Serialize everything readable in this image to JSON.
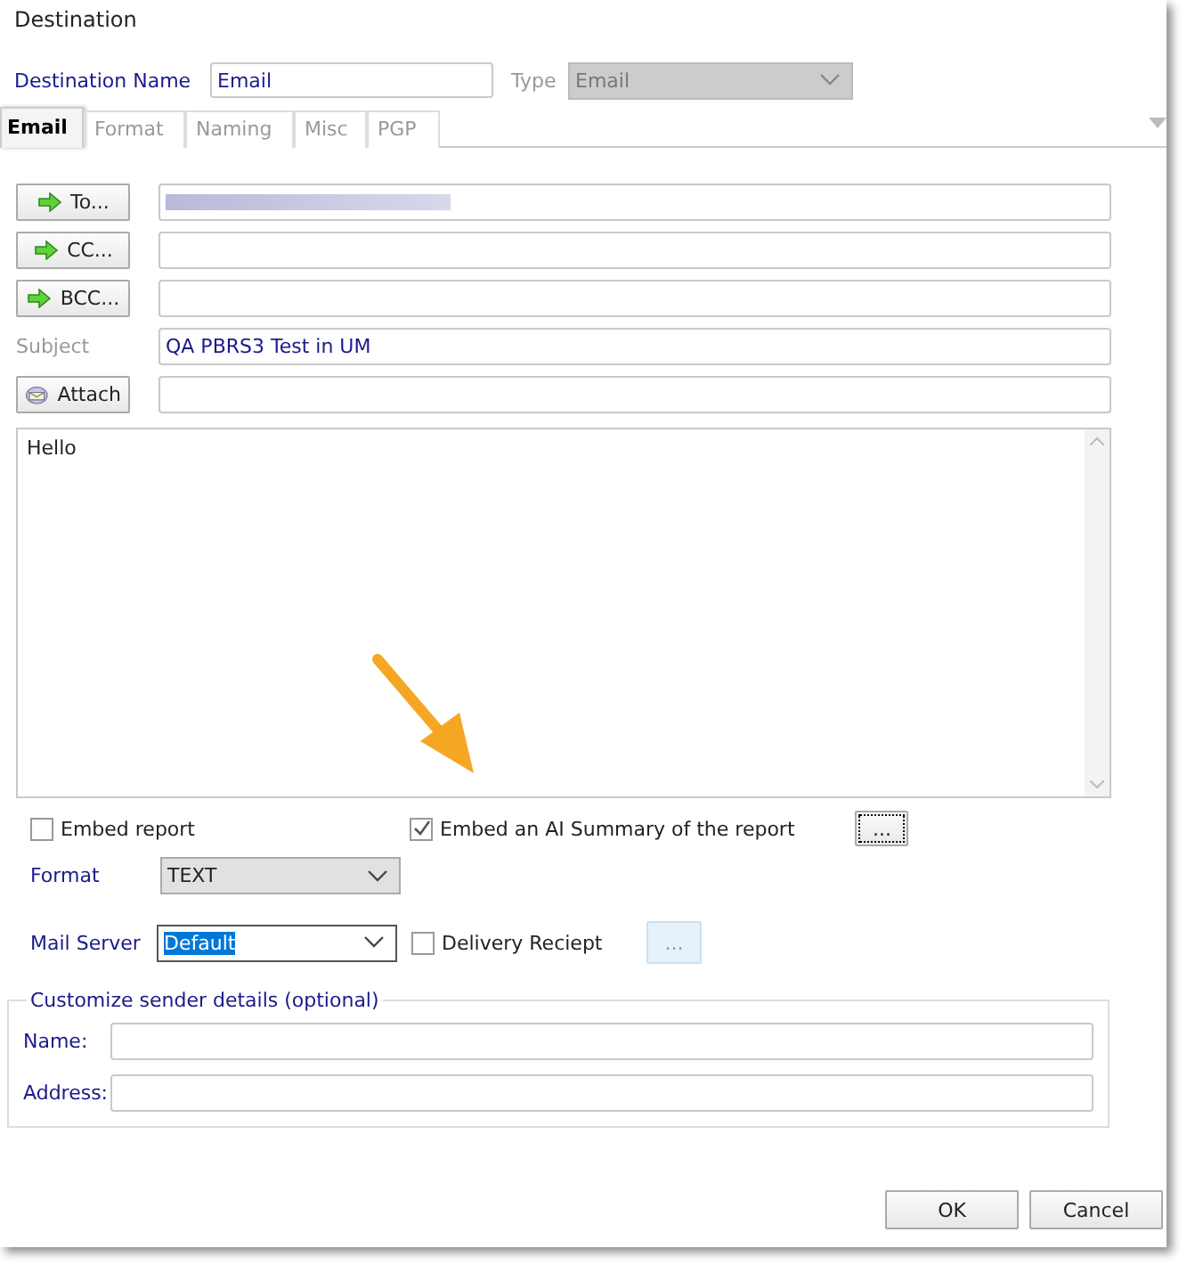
{
  "window": {
    "title": "Destination"
  },
  "destination_name": {
    "label": "Destination Name",
    "value": "Email"
  },
  "type": {
    "label": "Type",
    "value": "Email",
    "disabled": true
  },
  "tabs": [
    {
      "label": "Email",
      "selected": true
    },
    {
      "label": "Format",
      "selected": false
    },
    {
      "label": "Naming",
      "selected": false
    },
    {
      "label": "Misc",
      "selected": false
    },
    {
      "label": "PGP",
      "selected": false
    }
  ],
  "recipients": [
    {
      "kind": "button",
      "label": "To...",
      "redacted": true
    },
    {
      "kind": "button",
      "label": "CC...",
      "redacted": false
    },
    {
      "kind": "button",
      "label": "BCC...",
      "redacted": false
    },
    {
      "kind": "label",
      "label": "Subject",
      "value": "QA PBRS3 Test in UM",
      "redacted": false
    },
    {
      "kind": "attach",
      "label": "Attach",
      "redacted": false
    }
  ],
  "message_body": "Hello",
  "embed_report": {
    "label": "Embed report",
    "checked": false
  },
  "embed_ai_summary": {
    "label": "Embed an AI Summary of the report",
    "checked": true,
    "button": "..."
  },
  "format": {
    "label": "Format",
    "value": "TEXT"
  },
  "mail_server": {
    "label": "Mail Server",
    "value": "Default",
    "selected": true
  },
  "delivery_receipt": {
    "label": "Delivery Reciept",
    "checked": false,
    "button": "...",
    "button_disabled": true
  },
  "sender_group": {
    "title": "Customize sender details (optional)",
    "fields": [
      {
        "label": "Name:"
      },
      {
        "label": "Address:"
      }
    ]
  },
  "buttons": [
    "OK",
    "Cancel"
  ]
}
